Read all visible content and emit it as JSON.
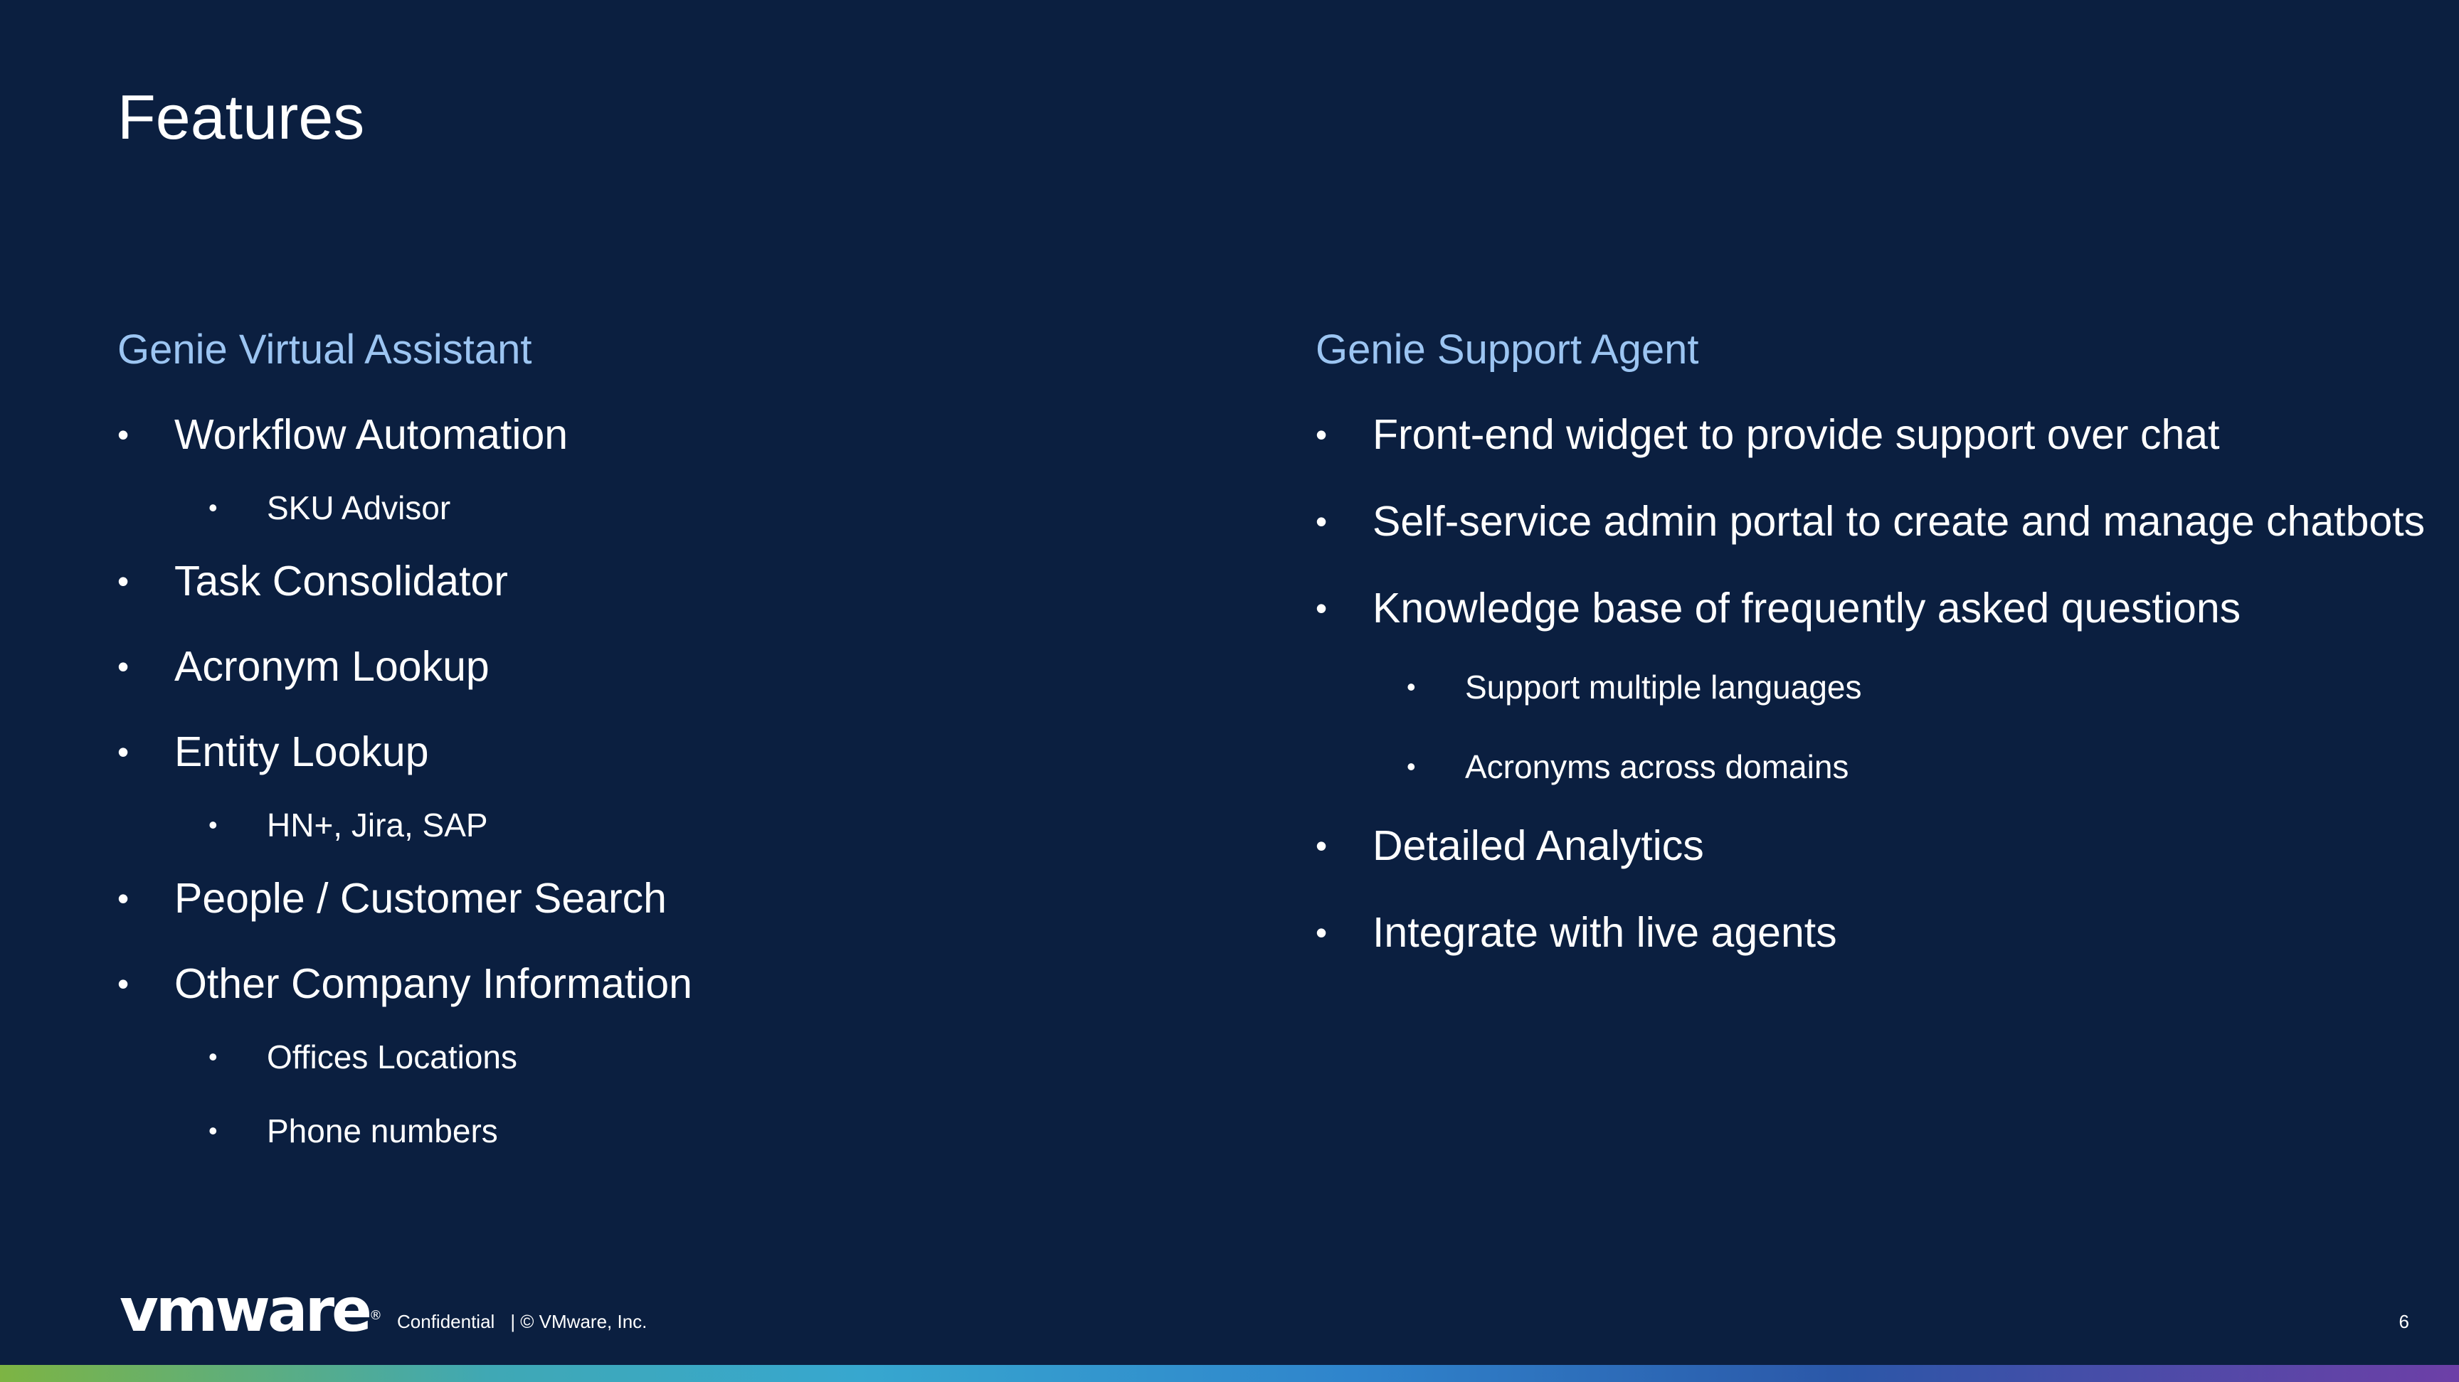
{
  "slide": {
    "title": "Features"
  },
  "left_column": {
    "heading": "Genie Virtual Assistant",
    "items": [
      {
        "text": "Workflow Automation",
        "level": 1
      },
      {
        "text": "SKU Advisor",
        "level": 2
      },
      {
        "text": "Task Consolidator",
        "level": 1
      },
      {
        "text": "Acronym Lookup",
        "level": 1
      },
      {
        "text": "Entity Lookup",
        "level": 1
      },
      {
        "text": "HN+, Jira, SAP",
        "level": 2
      },
      {
        "text": "People / Customer Search",
        "level": 1
      },
      {
        "text": "Other Company Information",
        "level": 1
      },
      {
        "text": "Offices Locations",
        "level": 2
      },
      {
        "text": "Phone numbers",
        "level": 2
      }
    ]
  },
  "right_column": {
    "heading": "Genie Support Agent",
    "items": [
      {
        "text": "Front-end widget to provide support over chat",
        "level": 1
      },
      {
        "text": "Self-service admin portal to create and manage chatbots",
        "level": 1
      },
      {
        "text": "Knowledge base of frequently asked questions",
        "level": 1
      },
      {
        "text": "Support multiple languages",
        "level": 2
      },
      {
        "text": "Acronyms across domains",
        "level": 2
      },
      {
        "text": "Detailed Analytics",
        "level": 1
      },
      {
        "text": "Integrate with live agents",
        "level": 1
      }
    ]
  },
  "footer": {
    "logo": "vmware",
    "logo_mark": "®",
    "confidential": "Confidential",
    "copyright": "| © VMware, Inc.",
    "page_number": "6"
  },
  "colors": {
    "background": "#0b1f40",
    "heading_accent": "#9cc5f2",
    "text": "#ffffff"
  }
}
